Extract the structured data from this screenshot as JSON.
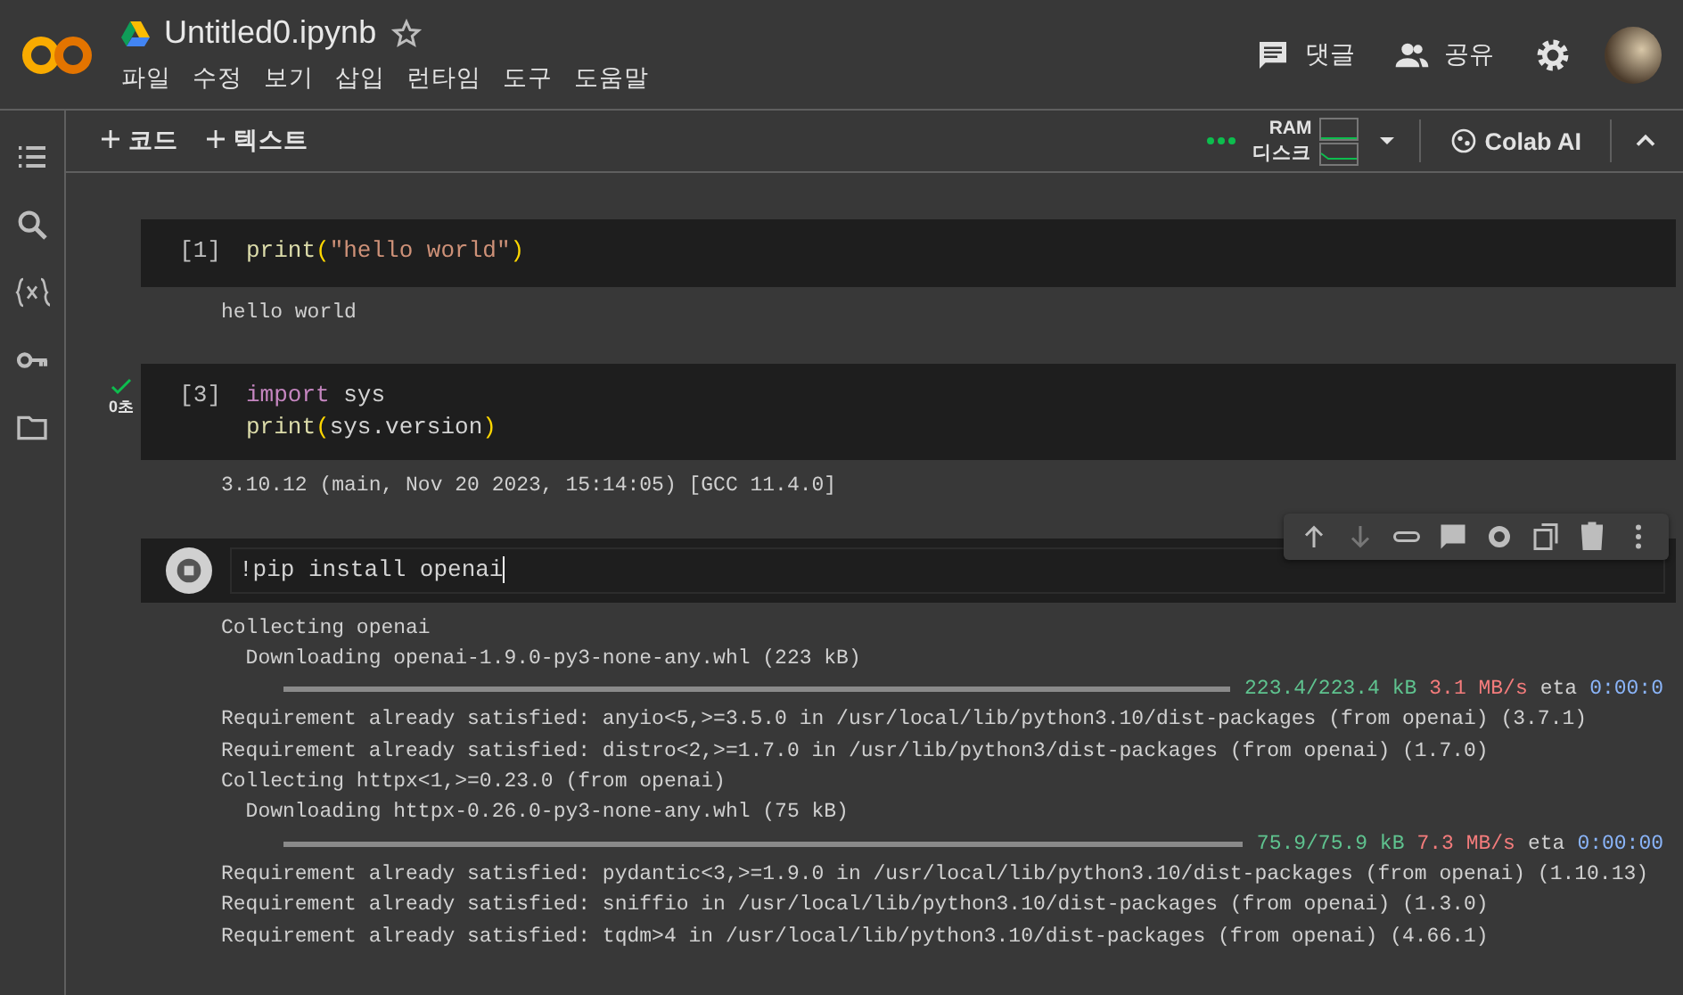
{
  "header": {
    "title": "Untitled0.ipynb",
    "starred": false,
    "menu": [
      "파일",
      "수정",
      "보기",
      "삽입",
      "런타임",
      "도구",
      "도움말"
    ],
    "actions": [
      {
        "kind": "comment",
        "label": "댓글"
      },
      {
        "kind": "share",
        "label": "공유"
      }
    ]
  },
  "toolbar": {
    "add": [
      "코드",
      "텍스트"
    ],
    "resources": {
      "ram": "RAM",
      "disk": "디스크"
    },
    "ai": "Colab AI"
  },
  "cells": [
    {
      "kind": "done",
      "count": "[1]",
      "code": [
        [
          {
            "t": "print",
            "kind": "fn"
          },
          {
            "t": "(",
            "kind": "paren"
          },
          {
            "t": "\"hello world\"",
            "kind": "str"
          },
          {
            "t": ")",
            "kind": "paren"
          }
        ]
      ],
      "output": [
        {
          "kind": "text",
          "text": "hello world"
        }
      ]
    },
    {
      "kind": "done",
      "count": "[3]",
      "status": "0초",
      "code": [
        [
          {
            "t": "import",
            "kind": "kw"
          },
          {
            "t": " sys",
            "kind": "plain"
          }
        ],
        [
          {
            "t": "print",
            "kind": "fn"
          },
          {
            "t": "(",
            "kind": "paren"
          },
          {
            "t": "sys.version",
            "kind": "plain"
          },
          {
            "t": ")",
            "kind": "paren"
          }
        ]
      ],
      "output": [
        {
          "kind": "text",
          "text": "3.10.12 (main, Nov 20 2023, 15:14:05) [GCC 11.4.0]"
        }
      ]
    },
    {
      "kind": "running",
      "code": [
        [
          {
            "t": "!pip install openai",
            "kind": "plain"
          }
        ]
      ],
      "output": [
        {
          "kind": "text",
          "text": "Collecting openai"
        },
        {
          "kind": "text",
          "text": "  Downloading openai-1.9.0-py3-none-any.whl (223 kB)"
        },
        {
          "kind": "progress",
          "size": "223.4/223.4 kB",
          "speed": "3.1 MB/s",
          "eta_label": "eta",
          "eta": "0:00:0"
        },
        {
          "kind": "text",
          "text": "Requirement already satisfied: anyio<5,>=3.5.0 in /usr/local/lib/python3.10/dist-packages (from openai) (3.7.1)"
        },
        {
          "kind": "text",
          "text": "Requirement already satisfied: distro<2,>=1.7.0 in /usr/lib/python3/dist-packages (from openai) (1.7.0)"
        },
        {
          "kind": "text",
          "text": "Collecting httpx<1,>=0.23.0 (from openai)"
        },
        {
          "kind": "text",
          "text": "  Downloading httpx-0.26.0-py3-none-any.whl (75 kB)"
        },
        {
          "kind": "progress",
          "size": "75.9/75.9 kB",
          "speed": "7.3 MB/s",
          "eta_label": "eta",
          "eta": "0:00:00"
        },
        {
          "kind": "text",
          "text": "Requirement already satisfied: pydantic<3,>=1.9.0 in /usr/local/lib/python3.10/dist-packages (from openai) (1.10.13)"
        },
        {
          "kind": "text",
          "text": "Requirement already satisfied: sniffio in /usr/local/lib/python3.10/dist-packages (from openai) (1.3.0)"
        },
        {
          "kind": "text",
          "text": "Requirement already satisfied: tqdm>4 in /usr/local/lib/python3.10/dist-packages (from openai) (4.66.1)"
        }
      ]
    }
  ]
}
